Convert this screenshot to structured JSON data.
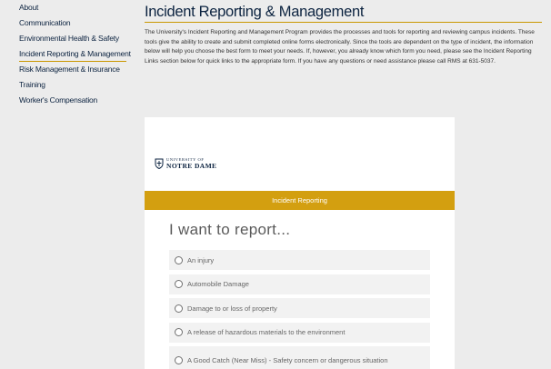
{
  "sidebar": {
    "items": [
      {
        "label": "About"
      },
      {
        "label": "Communication"
      },
      {
        "label": "Environmental Health & Safety"
      },
      {
        "label": "Incident Reporting & Management"
      },
      {
        "label": "Risk Management & Insurance"
      },
      {
        "label": "Training"
      },
      {
        "label": "Worker's Compensation"
      }
    ],
    "active_index": 3
  },
  "main": {
    "title": "Incident Reporting & Management",
    "intro": "The University's Incident Reporting and Management Program provides the processes and tools for reporting and reviewing campus incidents. These tools give the ability to create and submit completed online forms electronically. Since the tools are dependent on the type of incident, the information below will help you choose the best form to meet your needs. If, however, you already know which form you need, please see the Incident Reporting Links section below for quick links to the appropriate form. If you have any questions or need assistance please call RMS at 631-5037."
  },
  "form": {
    "logo": {
      "line1": "UNIVERSITY OF",
      "line2": "NOTRE DAME",
      "icon": "shield-icon"
    },
    "banner": "Incident Reporting",
    "heading": "I want to report...",
    "options": [
      {
        "label": "An injury"
      },
      {
        "label": "Automobile Damage"
      },
      {
        "label": "Damage to or loss of property"
      },
      {
        "label": "A release of hazardous materials to the environment"
      },
      {
        "label": "A Good Catch (Near Miss) - Safety concern or dangerous situation"
      }
    ]
  },
  "colors": {
    "navy": "#0c2340",
    "gold": "#c99700",
    "banner": "#d39f10",
    "background": "#ececec"
  }
}
